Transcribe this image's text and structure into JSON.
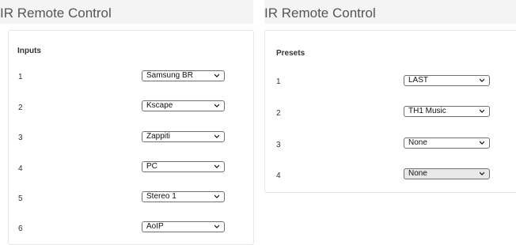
{
  "inputs_panel": {
    "title": "IR Remote Control",
    "section_title": "Inputs",
    "rows": [
      {
        "label": "1",
        "value": "Samsung BR"
      },
      {
        "label": "2",
        "value": "Kscape"
      },
      {
        "label": "3",
        "value": "Zappiti"
      },
      {
        "label": "4",
        "value": "PC"
      },
      {
        "label": "5",
        "value": "Stereo 1"
      },
      {
        "label": "6",
        "value": "AoIP"
      }
    ]
  },
  "presets_panel": {
    "title": "IR Remote Control",
    "section_title": "Presets",
    "rows": [
      {
        "label": "1",
        "value": "LAST"
      },
      {
        "label": "2",
        "value": "TH1 Music"
      },
      {
        "label": "3",
        "value": "None"
      },
      {
        "label": "4",
        "value": "None"
      }
    ]
  },
  "icons": {
    "dropdown": "chevron-down-icon"
  },
  "colors": {
    "header_bg": "#f4f4f4",
    "title_text": "#555555",
    "card_border": "#e6e6e6",
    "select_border": "#6f6f6f",
    "active_select_bg": "#e9e9e9"
  }
}
